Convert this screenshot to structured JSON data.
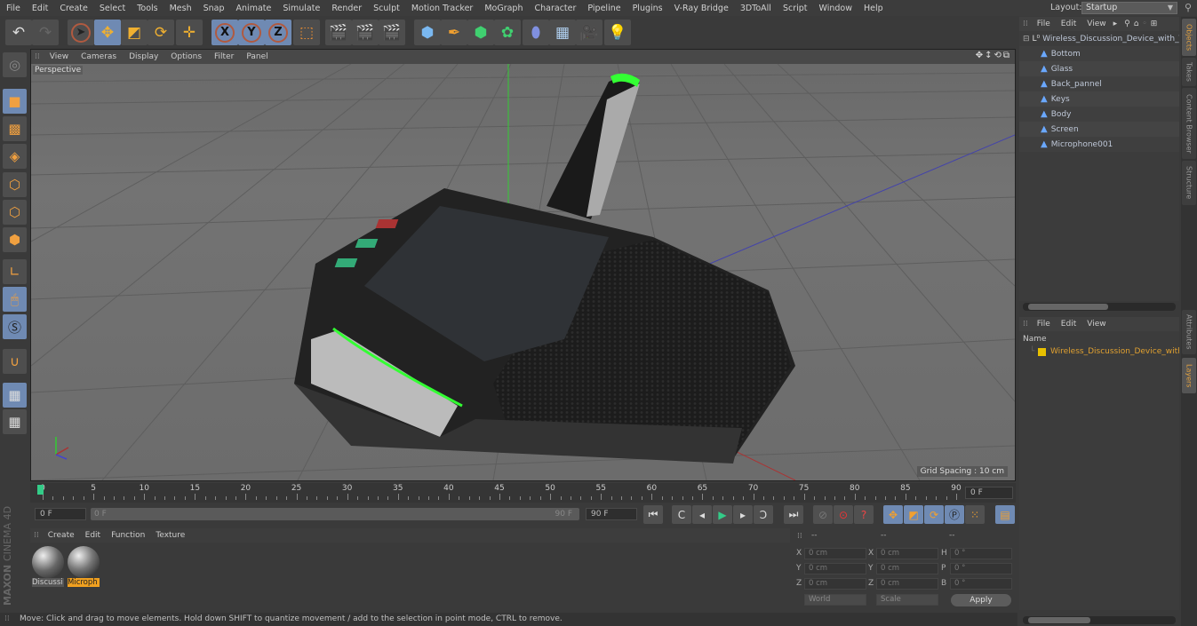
{
  "menubar": {
    "items": [
      "File",
      "Edit",
      "Create",
      "Select",
      "Tools",
      "Mesh",
      "Snap",
      "Animate",
      "Simulate",
      "Render",
      "Sculpt",
      "Motion Tracker",
      "MoGraph",
      "Character",
      "Pipeline",
      "Plugins",
      "V-Ray Bridge",
      "3DToAll",
      "Script",
      "Window",
      "Help"
    ],
    "layout_label": "Layout:",
    "layout_value": "Startup"
  },
  "toolbar": {
    "axis_x": "X",
    "axis_y": "Y",
    "axis_z": "Z"
  },
  "viewport": {
    "menu": [
      "View",
      "Cameras",
      "Display",
      "Options",
      "Filter",
      "Panel"
    ],
    "camera_label": "Perspective",
    "grid_spacing": "Grid Spacing : 10 cm"
  },
  "object_manager": {
    "menu": [
      "File",
      "Edit",
      "View"
    ],
    "root": "Wireless_Discussion_Device_with_T",
    "children": [
      "Bottom",
      "Glass",
      "Back_pannel",
      "Keys",
      "Body",
      "Screen",
      "Microphone001"
    ]
  },
  "side_tabs": [
    "Objects",
    "Takes",
    "Content Browser",
    "Structure",
    "Attributes",
    "Layers"
  ],
  "layer_manager": {
    "menu": [
      "File",
      "Edit",
      "View"
    ],
    "column_name": "Name",
    "layer": "Wireless_Discussion_Device_with_",
    "layer_color": "#e8c000"
  },
  "timeline": {
    "ticks": [
      "0",
      "5",
      "10",
      "15",
      "20",
      "25",
      "30",
      "35",
      "40",
      "45",
      "50",
      "55",
      "60",
      "65",
      "70",
      "75",
      "80",
      "85",
      "90"
    ],
    "current_frame": "0 F",
    "start_frame": "0 F",
    "range_start": "0 F",
    "range_end": "90 F",
    "end_frame": "90 F"
  },
  "material_manager": {
    "menu": [
      "Create",
      "Edit",
      "Function",
      "Texture"
    ],
    "materials": [
      {
        "name": "Discussi",
        "selected": false
      },
      {
        "name": "Microph",
        "selected": true
      }
    ]
  },
  "coordinates": {
    "headers": [
      "--",
      "--",
      "--"
    ],
    "rows": [
      {
        "l1": "X",
        "v1": "0 cm",
        "l2": "X",
        "v2": "0 cm",
        "l3": "H",
        "v3": "0 °"
      },
      {
        "l1": "Y",
        "v1": "0 cm",
        "l2": "Y",
        "v2": "0 cm",
        "l3": "P",
        "v3": "0 °"
      },
      {
        "l1": "Z",
        "v1": "0 cm",
        "l2": "Z",
        "v2": "0 cm",
        "l3": "B",
        "v3": "0 °"
      }
    ],
    "mode": "World",
    "transform": "Scale",
    "apply_label": "Apply"
  },
  "branding": {
    "line1": "MAXON",
    "line2": "CINEMA 4D"
  },
  "status": "Move: Click and drag to move elements. Hold down SHIFT to quantize movement / add to the selection in point mode, CTRL to remove."
}
